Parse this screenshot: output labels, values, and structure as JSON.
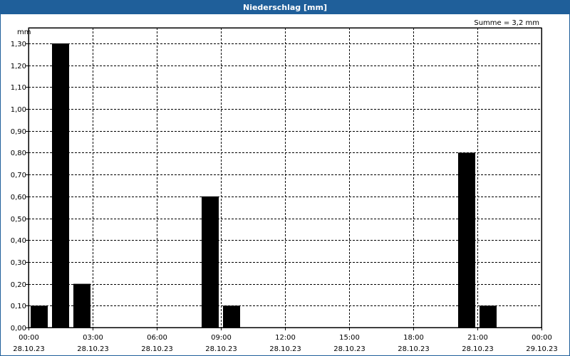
{
  "window": {
    "title": "Niederschlag [mm]"
  },
  "summary": {
    "text": "Summe = 3,2 mm"
  },
  "chart_data": {
    "type": "bar",
    "title": "Niederschlag [mm]",
    "ylabel": "mm",
    "xlabel": "",
    "ylim": [
      0,
      1.3
    ],
    "yticks": [
      "0,00",
      "0,10",
      "0,20",
      "0,30",
      "0,40",
      "0,50",
      "0,60",
      "0,70",
      "0,80",
      "0,90",
      "1,00",
      "1,10",
      "1,20",
      "1,30"
    ],
    "xlim_hours": [
      0,
      24
    ],
    "xticks": [
      {
        "time": "00:00",
        "date": "28.10.23"
      },
      {
        "time": "03:00",
        "date": "28.10.23"
      },
      {
        "time": "06:00",
        "date": "28.10.23"
      },
      {
        "time": "09:00",
        "date": "28.10.23"
      },
      {
        "time": "12:00",
        "date": "28.10.23"
      },
      {
        "time": "15:00",
        "date": "28.10.23"
      },
      {
        "time": "18:00",
        "date": "28.10.23"
      },
      {
        "time": "21:00",
        "date": "28.10.23"
      },
      {
        "time": "00:00",
        "date": "29.10.23"
      }
    ],
    "bars": [
      {
        "start": "00:00",
        "end": "01:00",
        "value": 0.1
      },
      {
        "start": "01:00",
        "end": "02:00",
        "value": 1.3
      },
      {
        "start": "02:00",
        "end": "03:00",
        "value": 0.2
      },
      {
        "start": "08:00",
        "end": "09:00",
        "value": 0.6
      },
      {
        "start": "09:00",
        "end": "10:00",
        "value": 0.1
      },
      {
        "start": "20:00",
        "end": "21:00",
        "value": 0.8
      },
      {
        "start": "21:00",
        "end": "22:00",
        "value": 0.1
      }
    ],
    "grid": true,
    "bar_color": "#000000",
    "grid_color": "#000000"
  }
}
